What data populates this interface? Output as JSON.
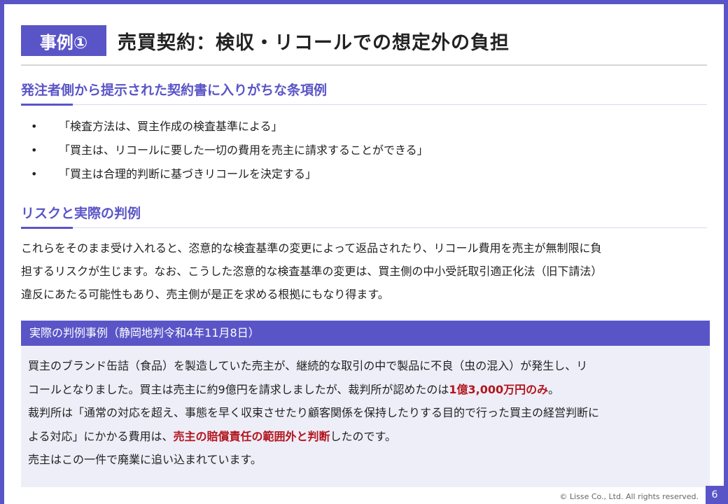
{
  "header": {
    "badge": "事例①",
    "title": "売買契約：検収・リコールでの想定外の負担"
  },
  "section1": {
    "heading": "発注者側から提示された契約書に入りがちな条項例",
    "bullet_glyph": "•",
    "items": [
      "「検査方法は、買主作成の検査基準による」",
      "「買主は、リコールに要した一切の費用を売主に請求することができる」",
      "「買主は合理的判断に基づきリコールを決定する」"
    ]
  },
  "section2": {
    "heading": "リスクと実際の判例",
    "lines": [
      "これらをそのまま受け入れると、恣意的な検査基準の変更によって返品されたり、リコール費用を売主が無制限に負",
      "担するリスクが生じます。なお、こうした恣意的な検査基準の変更は、買主側の中小受託取引適正化法（旧下請法）",
      "違反にあたる可能性もあり、売主側が是正を求める根拠にもなり得ます。"
    ]
  },
  "case": {
    "header": "実際の判例事例（静岡地判令和4年11月8日）",
    "line1": "買主のブランド缶詰（食品）を製造していた売主が、継続的な取引の中で製品に不良（虫の混入）が発生し、リ",
    "line2_pre": "コールとなりました。買主は売主に約9億円を請求しましたが、裁判所が認めたのは",
    "line2_hl": "1億3,000万円のみ",
    "line2_post": "。",
    "line3": "裁判所は「通常の対応を超え、事態を早く収束させたり顧客関係を保持したりする目的で行った買主の経営判断に",
    "line4_pre": "よる対応」にかかる費用は、",
    "line4_hl": "売主の賠償責任の範囲外と判断",
    "line4_post": "したのです。",
    "line5": "売主はこの一件で廃業に追い込まれています。"
  },
  "footer": {
    "copyright": "© Lisse Co., Ltd. All rights reserved.",
    "page": "6"
  },
  "colors": {
    "accent": "#5a55c7",
    "highlight": "#b3161e",
    "case_bg": "#eeeef8"
  }
}
